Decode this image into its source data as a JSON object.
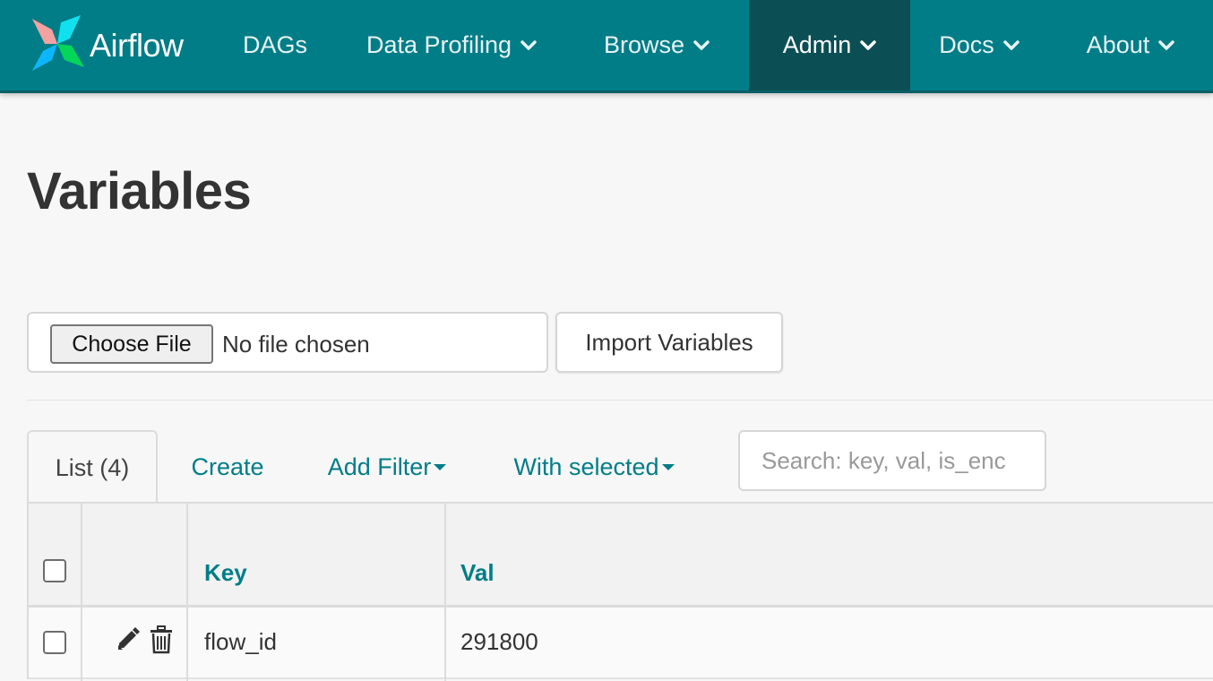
{
  "navbar": {
    "brand": "Airflow",
    "items": [
      {
        "label": "DAGs",
        "dropdown": false
      },
      {
        "label": "Data Profiling",
        "dropdown": true
      },
      {
        "label": "Browse",
        "dropdown": true
      },
      {
        "label": "Admin",
        "dropdown": true,
        "active": true
      },
      {
        "label": "Docs",
        "dropdown": true
      },
      {
        "label": "About",
        "dropdown": true
      }
    ]
  },
  "page": {
    "title": "Variables"
  },
  "import_form": {
    "choose_file_label": "Choose File",
    "file_status": "No file chosen",
    "import_button_label": "Import Variables"
  },
  "tabs": {
    "list": "List (4)",
    "create": "Create",
    "add_filter": "Add Filter",
    "with_selected": "With selected"
  },
  "search": {
    "placeholder": "Search: key, val, is_enc"
  },
  "table": {
    "columns": [
      "",
      "",
      "Key",
      "Val"
    ],
    "rows": [
      {
        "key": "flow_id",
        "val": "291800"
      }
    ]
  },
  "colors": {
    "navbar_bg": "#017d87",
    "navbar_active": "#0b4f55",
    "link": "#017d87",
    "page_bg": "#f7f7f7"
  },
  "icons": [
    "pinwheel-logo-icon",
    "chevron-down-icon",
    "caret-down-icon",
    "pencil-icon",
    "trash-icon"
  ]
}
